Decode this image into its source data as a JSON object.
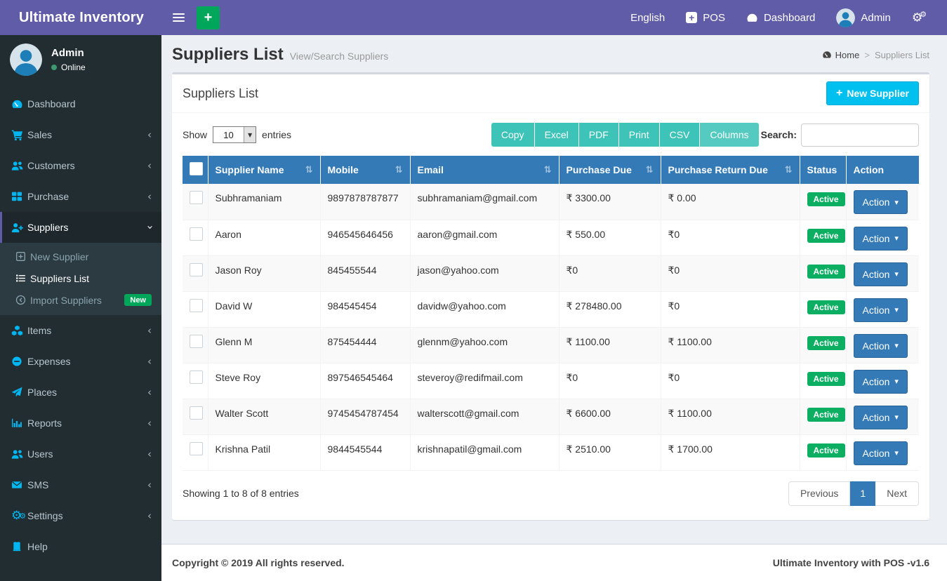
{
  "navbar": {
    "brand": "Ultimate Inventory",
    "language": "English",
    "pos_label": "POS",
    "dashboard_label": "Dashboard",
    "user_name": "Admin"
  },
  "sidebar": {
    "user_name": "Admin",
    "user_status": "Online",
    "items": [
      {
        "label": "Dashboard"
      },
      {
        "label": "Sales"
      },
      {
        "label": "Customers"
      },
      {
        "label": "Purchase"
      },
      {
        "label": "Suppliers"
      },
      {
        "label": "Items"
      },
      {
        "label": "Expenses"
      },
      {
        "label": "Places"
      },
      {
        "label": "Reports"
      },
      {
        "label": "Users"
      },
      {
        "label": "SMS"
      },
      {
        "label": "Settings"
      },
      {
        "label": "Help"
      }
    ],
    "suppliers_submenu": [
      {
        "label": "New Supplier"
      },
      {
        "label": "Suppliers List"
      },
      {
        "label": "Import Suppliers",
        "badge": "New"
      }
    ]
  },
  "page": {
    "title": "Suppliers List",
    "subtitle": "View/Search Suppliers",
    "breadcrumb_home": "Home",
    "breadcrumb_current": "Suppliers List"
  },
  "card": {
    "title": "Suppliers List",
    "new_supplier_label": "New Supplier",
    "show_label": "Show",
    "page_size": "10",
    "entries_label": "entries",
    "export_buttons": [
      "Copy",
      "Excel",
      "PDF",
      "Print",
      "CSV",
      "Columns"
    ],
    "search_label": "Search:",
    "search_value": ""
  },
  "table": {
    "headers": [
      "Supplier Name",
      "Mobile",
      "Email",
      "Purchase Due",
      "Purchase Return Due",
      "Status",
      "Action"
    ],
    "rows": [
      {
        "name": "Subhramaniam",
        "mobile": "9897878787877",
        "email": "subhramaniam@gmail.com",
        "purchase_due": "₹ 3300.00",
        "purchase_return_due": "₹ 0.00",
        "status": "Active",
        "action": "Action"
      },
      {
        "name": "Aaron",
        "mobile": "946545646456",
        "email": "aaron@gmail.com",
        "purchase_due": "₹ 550.00",
        "purchase_return_due": "₹0",
        "status": "Active",
        "action": "Action"
      },
      {
        "name": "Jason Roy",
        "mobile": "845455544",
        "email": "jason@yahoo.com",
        "purchase_due": "₹0",
        "purchase_return_due": "₹0",
        "status": "Active",
        "action": "Action"
      },
      {
        "name": "David W",
        "mobile": "984545454",
        "email": "davidw@yahoo.com",
        "purchase_due": "₹ 278480.00",
        "purchase_return_due": "₹0",
        "status": "Active",
        "action": "Action"
      },
      {
        "name": "Glenn M",
        "mobile": "875454444",
        "email": "glennm@yahoo.com",
        "purchase_due": "₹ 1100.00",
        "purchase_return_due": "₹ 1100.00",
        "status": "Active",
        "action": "Action"
      },
      {
        "name": "Steve Roy",
        "mobile": "897546545464",
        "email": "steveroy@redifmail.com",
        "purchase_due": "₹0",
        "purchase_return_due": "₹0",
        "status": "Active",
        "action": "Action"
      },
      {
        "name": "Walter Scott",
        "mobile": "9745454787454",
        "email": "walterscott@gmail.com",
        "purchase_due": "₹ 6600.00",
        "purchase_return_due": "₹ 1100.00",
        "status": "Active",
        "action": "Action"
      },
      {
        "name": "Krishna Patil",
        "mobile": "9844545544",
        "email": "krishnapatil@gmail.com",
        "purchase_due": "₹ 2510.00",
        "purchase_return_due": "₹ 1700.00",
        "status": "Active",
        "action": "Action"
      }
    ],
    "summary": "Showing 1 to 8 of 8 entries",
    "pagination": {
      "previous": "Previous",
      "current": "1",
      "next": "Next"
    }
  },
  "footer": {
    "left": "Copyright © 2019 All rights reserved.",
    "right": "Ultimate Inventory with POS -v1.6"
  },
  "icons": {
    "plus": "+",
    "sort": "⇅",
    "caret_down": "▾",
    "chevron": "‹",
    "select_arrow": "▼",
    "gear": "⚙",
    "crumb_sep": ">"
  },
  "colors": {
    "navbar_purple": "#605ca8",
    "sidebar_dark": "#222d32",
    "submenu_dark": "#2c3b41",
    "icon_cyan": "#00b6f0",
    "table_header_blue": "#337ab7",
    "status_green": "#0caf62",
    "export_teal": "#3ec3b9",
    "new_supplier_cyan": "#00c0ef",
    "body_bg": "#ecf0f5"
  }
}
